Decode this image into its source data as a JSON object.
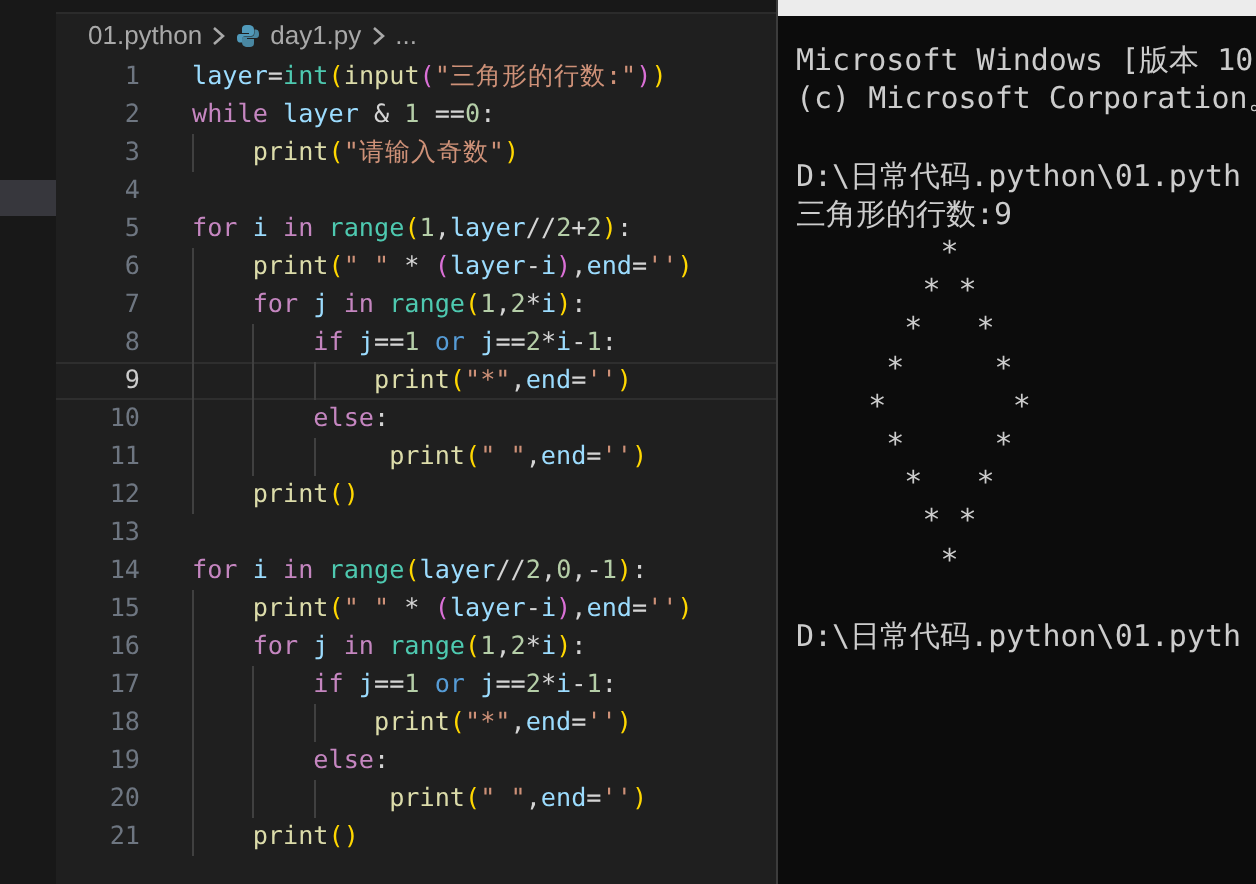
{
  "breadcrumb": [
    {
      "kind": "folder",
      "text": "01.python"
    },
    {
      "kind": "file",
      "text": "day1.py"
    },
    {
      "kind": "more",
      "text": "..."
    }
  ],
  "code_lines": [
    {
      "number": "1",
      "current": false,
      "tokens": [
        {
          "kind": "var",
          "text": "layer"
        },
        {
          "kind": "op",
          "text": "="
        },
        {
          "kind": "type",
          "text": "int"
        },
        {
          "kind": "b1",
          "text": "("
        },
        {
          "kind": "func",
          "text": "input"
        },
        {
          "kind": "b2",
          "text": "("
        },
        {
          "kind": "str",
          "text": "\"三角形的行数:\""
        },
        {
          "kind": "b2",
          "text": ")"
        },
        {
          "kind": "b1",
          "text": ")"
        }
      ]
    },
    {
      "number": "2",
      "current": false,
      "tokens": [
        {
          "kind": "control",
          "text": "while "
        },
        {
          "kind": "var",
          "text": "layer"
        },
        {
          "kind": "op",
          "text": " & "
        },
        {
          "kind": "num",
          "text": "1"
        },
        {
          "kind": "op",
          "text": " =="
        },
        {
          "kind": "num",
          "text": "0"
        },
        {
          "kind": "op",
          "text": ":"
        }
      ],
      "children": [
        {
          "number": "3",
          "current": false,
          "tokens": [
            {
              "kind": "func",
              "text": "print"
            },
            {
              "kind": "b1",
              "text": "("
            },
            {
              "kind": "str",
              "text": "\"请输入奇数\""
            },
            {
              "kind": "b1",
              "text": ")"
            }
          ]
        }
      ]
    },
    {
      "number": "4",
      "current": false
    },
    {
      "number": "5",
      "current": false,
      "tokens": [
        {
          "kind": "control",
          "text": "for "
        },
        {
          "kind": "var",
          "text": "i "
        },
        {
          "kind": "control",
          "text": "in "
        },
        {
          "kind": "type",
          "text": "range"
        },
        {
          "kind": "b1",
          "text": "("
        },
        {
          "kind": "num",
          "text": "1"
        },
        {
          "kind": "op",
          "text": ","
        },
        {
          "kind": "var",
          "text": "layer"
        },
        {
          "kind": "op",
          "text": "//"
        },
        {
          "kind": "num",
          "text": "2"
        },
        {
          "kind": "op",
          "text": "+"
        },
        {
          "kind": "num",
          "text": "2"
        },
        {
          "kind": "b1",
          "text": ")"
        },
        {
          "kind": "op",
          "text": ":"
        }
      ],
      "children": [
        {
          "number": "6",
          "current": false,
          "tokens": [
            {
              "kind": "func",
              "text": "print"
            },
            {
              "kind": "b1",
              "text": "("
            },
            {
              "kind": "str",
              "text": "\" \""
            },
            {
              "kind": "op",
              "text": " * "
            },
            {
              "kind": "b2",
              "text": "("
            },
            {
              "kind": "var",
              "text": "layer"
            },
            {
              "kind": "op",
              "text": "-"
            },
            {
              "kind": "var",
              "text": "i"
            },
            {
              "kind": "b2",
              "text": ")"
            },
            {
              "kind": "op",
              "text": ","
            },
            {
              "kind": "var",
              "text": "end"
            },
            {
              "kind": "op",
              "text": "="
            },
            {
              "kind": "str",
              "text": "''"
            },
            {
              "kind": "b1",
              "text": ")"
            }
          ]
        },
        {
          "number": "7",
          "current": false,
          "tokens": [
            {
              "kind": "control",
              "text": "for "
            },
            {
              "kind": "var",
              "text": "j "
            },
            {
              "kind": "control",
              "text": "in "
            },
            {
              "kind": "type",
              "text": "range"
            },
            {
              "kind": "b1",
              "text": "("
            },
            {
              "kind": "num",
              "text": "1"
            },
            {
              "kind": "op",
              "text": ","
            },
            {
              "kind": "num",
              "text": "2"
            },
            {
              "kind": "op",
              "text": "*"
            },
            {
              "kind": "var",
              "text": "i"
            },
            {
              "kind": "b1",
              "text": ")"
            },
            {
              "kind": "op",
              "text": ":"
            }
          ],
          "children": [
            {
              "number": "8",
              "current": false,
              "tokens": [
                {
                  "kind": "control",
                  "text": "if "
                },
                {
                  "kind": "var",
                  "text": "j"
                },
                {
                  "kind": "op",
                  "text": "=="
                },
                {
                  "kind": "num",
                  "text": "1 "
                },
                {
                  "kind": "keyword",
                  "text": "or "
                },
                {
                  "kind": "var",
                  "text": "j"
                },
                {
                  "kind": "op",
                  "text": "=="
                },
                {
                  "kind": "num",
                  "text": "2"
                },
                {
                  "kind": "op",
                  "text": "*"
                },
                {
                  "kind": "var",
                  "text": "i"
                },
                {
                  "kind": "op",
                  "text": "-"
                },
                {
                  "kind": "num",
                  "text": "1"
                },
                {
                  "kind": "op",
                  "text": ":"
                }
              ],
              "children": [
                {
                  "number": "9",
                  "current": true,
                  "tokens": [
                    {
                      "kind": "func",
                      "text": "print"
                    },
                    {
                      "kind": "b1",
                      "text": "("
                    },
                    {
                      "kind": "str",
                      "text": "\"*\""
                    },
                    {
                      "kind": "op",
                      "text": ","
                    },
                    {
                      "kind": "var",
                      "text": "end"
                    },
                    {
                      "kind": "op",
                      "text": "="
                    },
                    {
                      "kind": "str",
                      "text": "''"
                    },
                    {
                      "kind": "b1",
                      "text": ")"
                    }
                  ]
                }
              ]
            },
            {
              "number": "10",
              "current": false,
              "tokens": [
                {
                  "kind": "control",
                  "text": "else"
                },
                {
                  "kind": "op",
                  "text": ":"
                }
              ],
              "children": [
                {
                  "number": "11",
                  "current": false,
                  "tokens": [
                    {
                      "kind": "func",
                      "text": " print"
                    },
                    {
                      "kind": "b1",
                      "text": "("
                    },
                    {
                      "kind": "str",
                      "text": "\" \""
                    },
                    {
                      "kind": "op",
                      "text": ","
                    },
                    {
                      "kind": "var",
                      "text": "end"
                    },
                    {
                      "kind": "op",
                      "text": "="
                    },
                    {
                      "kind": "str",
                      "text": "''"
                    },
                    {
                      "kind": "b1",
                      "text": ")"
                    }
                  ]
                }
              ]
            }
          ]
        },
        {
          "number": "12",
          "current": false,
          "tokens": [
            {
              "kind": "func",
              "text": "print"
            },
            {
              "kind": "b1",
              "text": "("
            },
            {
              "kind": "b1",
              "text": ")"
            }
          ]
        }
      ]
    },
    {
      "number": "13",
      "current": false
    },
    {
      "number": "14",
      "current": false,
      "tokens": [
        {
          "kind": "control",
          "text": "for "
        },
        {
          "kind": "var",
          "text": "i "
        },
        {
          "kind": "control",
          "text": "in "
        },
        {
          "kind": "type",
          "text": "range"
        },
        {
          "kind": "b1",
          "text": "("
        },
        {
          "kind": "var",
          "text": "layer"
        },
        {
          "kind": "op",
          "text": "//"
        },
        {
          "kind": "num",
          "text": "2"
        },
        {
          "kind": "op",
          "text": ","
        },
        {
          "kind": "num",
          "text": "0"
        },
        {
          "kind": "op",
          "text": ",-"
        },
        {
          "kind": "num",
          "text": "1"
        },
        {
          "kind": "b1",
          "text": ")"
        },
        {
          "kind": "op",
          "text": ":"
        }
      ],
      "children": [
        {
          "number": "15",
          "current": false,
          "tokens": [
            {
              "kind": "func",
              "text": "print"
            },
            {
              "kind": "b1",
              "text": "("
            },
            {
              "kind": "str",
              "text": "\" \""
            },
            {
              "kind": "op",
              "text": " * "
            },
            {
              "kind": "b2",
              "text": "("
            },
            {
              "kind": "var",
              "text": "layer"
            },
            {
              "kind": "op",
              "text": "-"
            },
            {
              "kind": "var",
              "text": "i"
            },
            {
              "kind": "b2",
              "text": ")"
            },
            {
              "kind": "op",
              "text": ","
            },
            {
              "kind": "var",
              "text": "end"
            },
            {
              "kind": "op",
              "text": "="
            },
            {
              "kind": "str",
              "text": "''"
            },
            {
              "kind": "b1",
              "text": ")"
            }
          ]
        },
        {
          "number": "16",
          "current": false,
          "tokens": [
            {
              "kind": "control",
              "text": "for "
            },
            {
              "kind": "var",
              "text": "j "
            },
            {
              "kind": "control",
              "text": "in "
            },
            {
              "kind": "type",
              "text": "range"
            },
            {
              "kind": "b1",
              "text": "("
            },
            {
              "kind": "num",
              "text": "1"
            },
            {
              "kind": "op",
              "text": ","
            },
            {
              "kind": "num",
              "text": "2"
            },
            {
              "kind": "op",
              "text": "*"
            },
            {
              "kind": "var",
              "text": "i"
            },
            {
              "kind": "b1",
              "text": ")"
            },
            {
              "kind": "op",
              "text": ":"
            }
          ],
          "children": [
            {
              "number": "17",
              "current": false,
              "tokens": [
                {
                  "kind": "control",
                  "text": "if "
                },
                {
                  "kind": "var",
                  "text": "j"
                },
                {
                  "kind": "op",
                  "text": "=="
                },
                {
                  "kind": "num",
                  "text": "1 "
                },
                {
                  "kind": "keyword",
                  "text": "or "
                },
                {
                  "kind": "var",
                  "text": "j"
                },
                {
                  "kind": "op",
                  "text": "=="
                },
                {
                  "kind": "num",
                  "text": "2"
                },
                {
                  "kind": "op",
                  "text": "*"
                },
                {
                  "kind": "var",
                  "text": "i"
                },
                {
                  "kind": "op",
                  "text": "-"
                },
                {
                  "kind": "num",
                  "text": "1"
                },
                {
                  "kind": "op",
                  "text": ":"
                }
              ],
              "children": [
                {
                  "number": "18",
                  "current": false,
                  "tokens": [
                    {
                      "kind": "func",
                      "text": "print"
                    },
                    {
                      "kind": "b1",
                      "text": "("
                    },
                    {
                      "kind": "str",
                      "text": "\"*\""
                    },
                    {
                      "kind": "op",
                      "text": ","
                    },
                    {
                      "kind": "var",
                      "text": "end"
                    },
                    {
                      "kind": "op",
                      "text": "="
                    },
                    {
                      "kind": "str",
                      "text": "''"
                    },
                    {
                      "kind": "b1",
                      "text": ")"
                    }
                  ]
                }
              ]
            },
            {
              "number": "19",
              "current": false,
              "tokens": [
                {
                  "kind": "control",
                  "text": "else"
                },
                {
                  "kind": "op",
                  "text": ":"
                }
              ],
              "children": [
                {
                  "number": "20",
                  "current": false,
                  "tokens": [
                    {
                      "kind": "func",
                      "text": " print"
                    },
                    {
                      "kind": "b1",
                      "text": "("
                    },
                    {
                      "kind": "str",
                      "text": "\" \""
                    },
                    {
                      "kind": "op",
                      "text": ","
                    },
                    {
                      "kind": "var",
                      "text": "end"
                    },
                    {
                      "kind": "op",
                      "text": "="
                    },
                    {
                      "kind": "str",
                      "text": "''"
                    },
                    {
                      "kind": "b1",
                      "text": ")"
                    }
                  ]
                }
              ]
            }
          ]
        },
        {
          "number": "21",
          "current": false,
          "tokens": [
            {
              "kind": "func",
              "text": "print"
            },
            {
              "kind": "b1",
              "text": "("
            },
            {
              "kind": "b1",
              "text": ")"
            }
          ]
        }
      ]
    }
  ],
  "terminal_blocks": [
    {
      "lines": [
        {
          "kind": "text",
          "text": "Microsoft Windows [版本 10"
        },
        {
          "kind": "text",
          "text": "(c) Microsoft Corporation。"
        }
      ]
    },
    {
      "lines": [
        {
          "kind": "text",
          "text": "D:\\日常代码.python\\01.pyth"
        },
        {
          "kind": "text",
          "text": "三角形的行数:9"
        },
        {
          "kind": "pattern",
          "text": "*\n* *\n*   *\n*     *\n*       *\n*     *\n*   *\n* *\n*"
        }
      ]
    },
    {
      "lines": [
        {
          "kind": "text",
          "text": "D:\\日常代码.python\\01.pyth"
        }
      ]
    }
  ]
}
